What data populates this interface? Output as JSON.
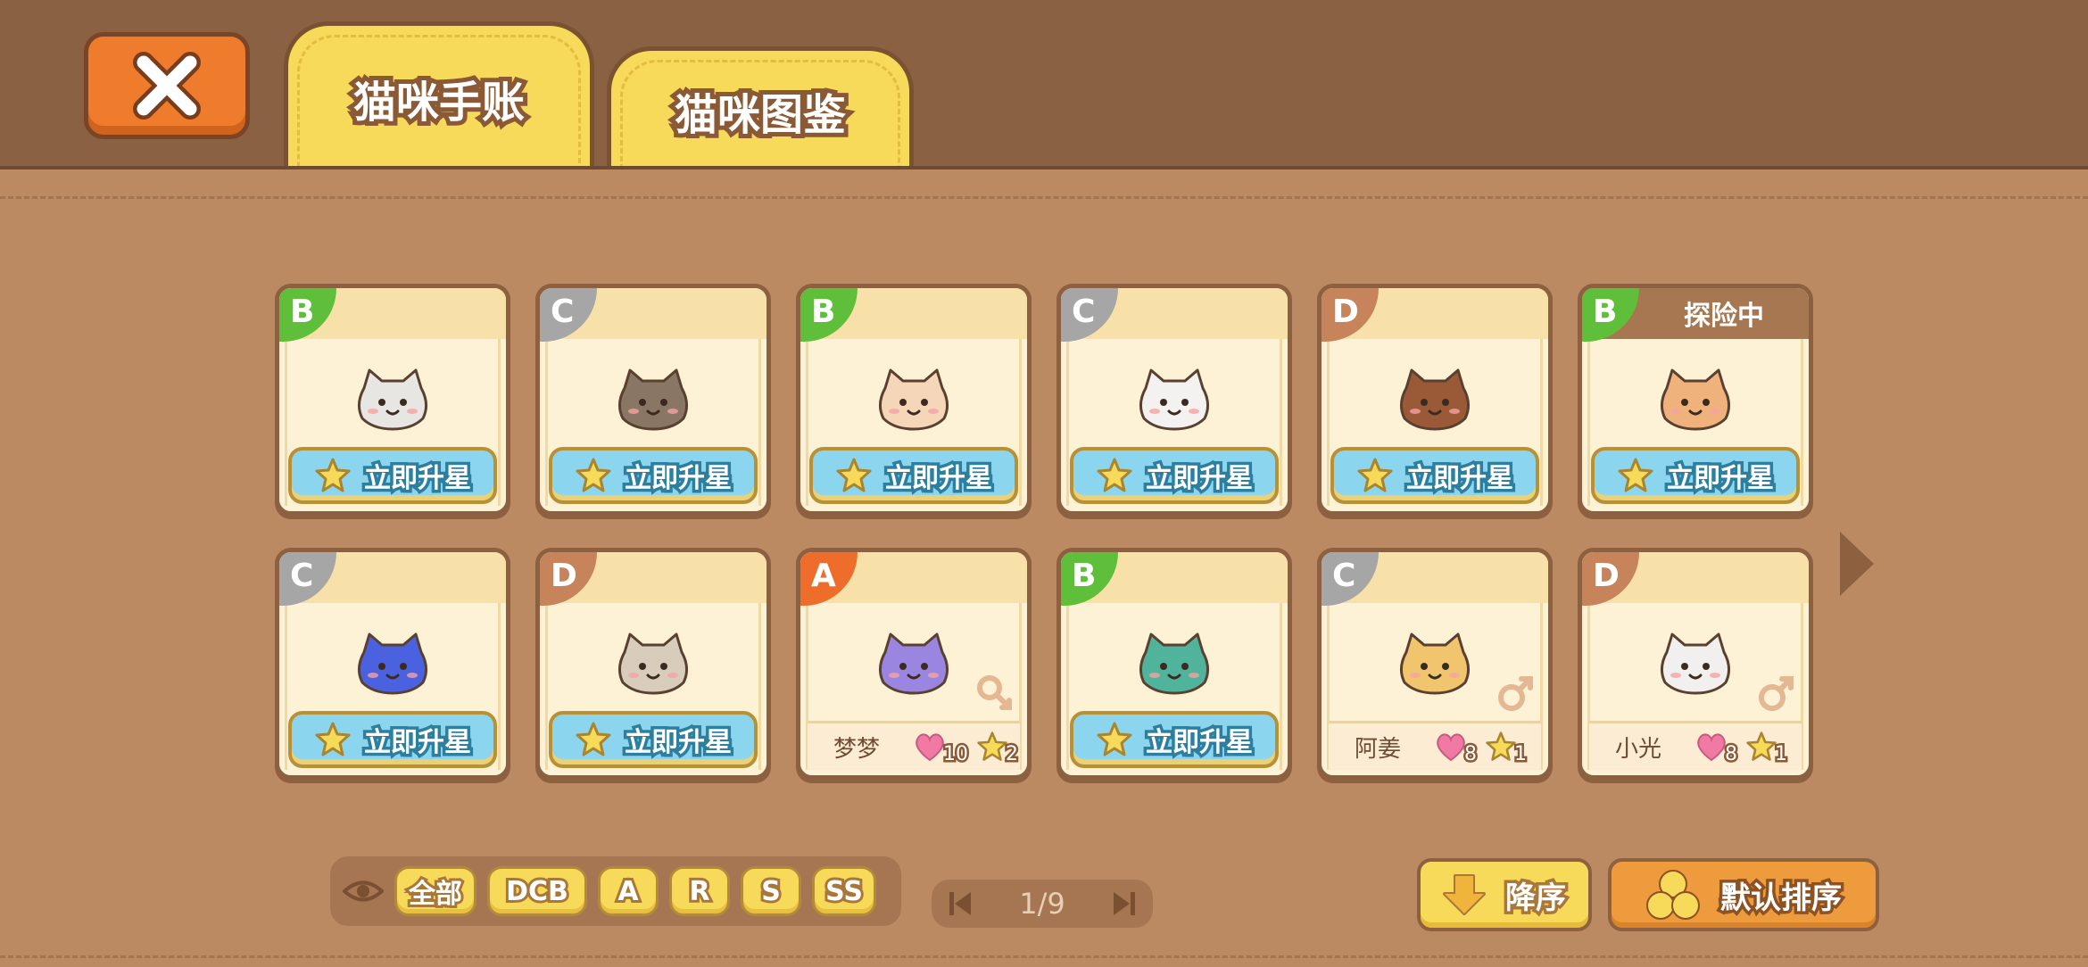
{
  "tabs": {
    "close_icon": "close-x-icon",
    "journal_label": "猫咪手账",
    "gallery_label": "猫咪图鉴"
  },
  "colors": {
    "grade_B": "#5fbf3a",
    "grade_C": "#a6a6a6",
    "grade_D": "#c7845a",
    "grade_A": "#ef6d2b",
    "tab_yellow": "#f8da5b",
    "upgrade_blue": "#8cd5ee"
  },
  "cards": [
    {
      "grade": "B",
      "status": "",
      "action": "立即升星",
      "cat_color": "#e8e6e2"
    },
    {
      "grade": "C",
      "status": "",
      "action": "立即升星",
      "cat_color": "#8a7664"
    },
    {
      "grade": "B",
      "status": "",
      "action": "立即升星",
      "cat_color": "#f6d6b8"
    },
    {
      "grade": "C",
      "status": "",
      "action": "立即升星",
      "cat_color": "#f4f2f0"
    },
    {
      "grade": "D",
      "status": "",
      "action": "立即升星",
      "cat_color": "#9a5a38"
    },
    {
      "grade": "B",
      "status": "探险中",
      "action": "立即升星",
      "cat_color": "#f0b27c"
    },
    {
      "grade": "C",
      "status": "",
      "action": "立即升星",
      "cat_color": "#4b62e0"
    },
    {
      "grade": "D",
      "status": "",
      "action": "立即升星",
      "cat_color": "#d8cdbb"
    },
    {
      "grade": "A",
      "status": "",
      "name": "梦梦",
      "hearts": "10",
      "stars": "2",
      "gender": "female",
      "cat_color": "#9a86e0"
    },
    {
      "grade": "B",
      "status": "",
      "action": "立即升星",
      "cat_color": "#4fb49b"
    },
    {
      "grade": "C",
      "status": "",
      "name": "阿姜",
      "hearts": "8",
      "stars": "1",
      "gender": "male",
      "cat_color": "#f0c56e"
    },
    {
      "grade": "D",
      "status": "",
      "name": "小光",
      "hearts": "8",
      "stars": "1",
      "gender": "male",
      "cat_color": "#f2f0ee"
    }
  ],
  "filters": {
    "eye_icon": "eye-icon",
    "options": [
      "全部",
      "DCB",
      "A",
      "R",
      "S",
      "SS"
    ]
  },
  "pager": {
    "label": "1/9"
  },
  "sort": {
    "descending_label": "降序",
    "default_label": "默认排序"
  }
}
